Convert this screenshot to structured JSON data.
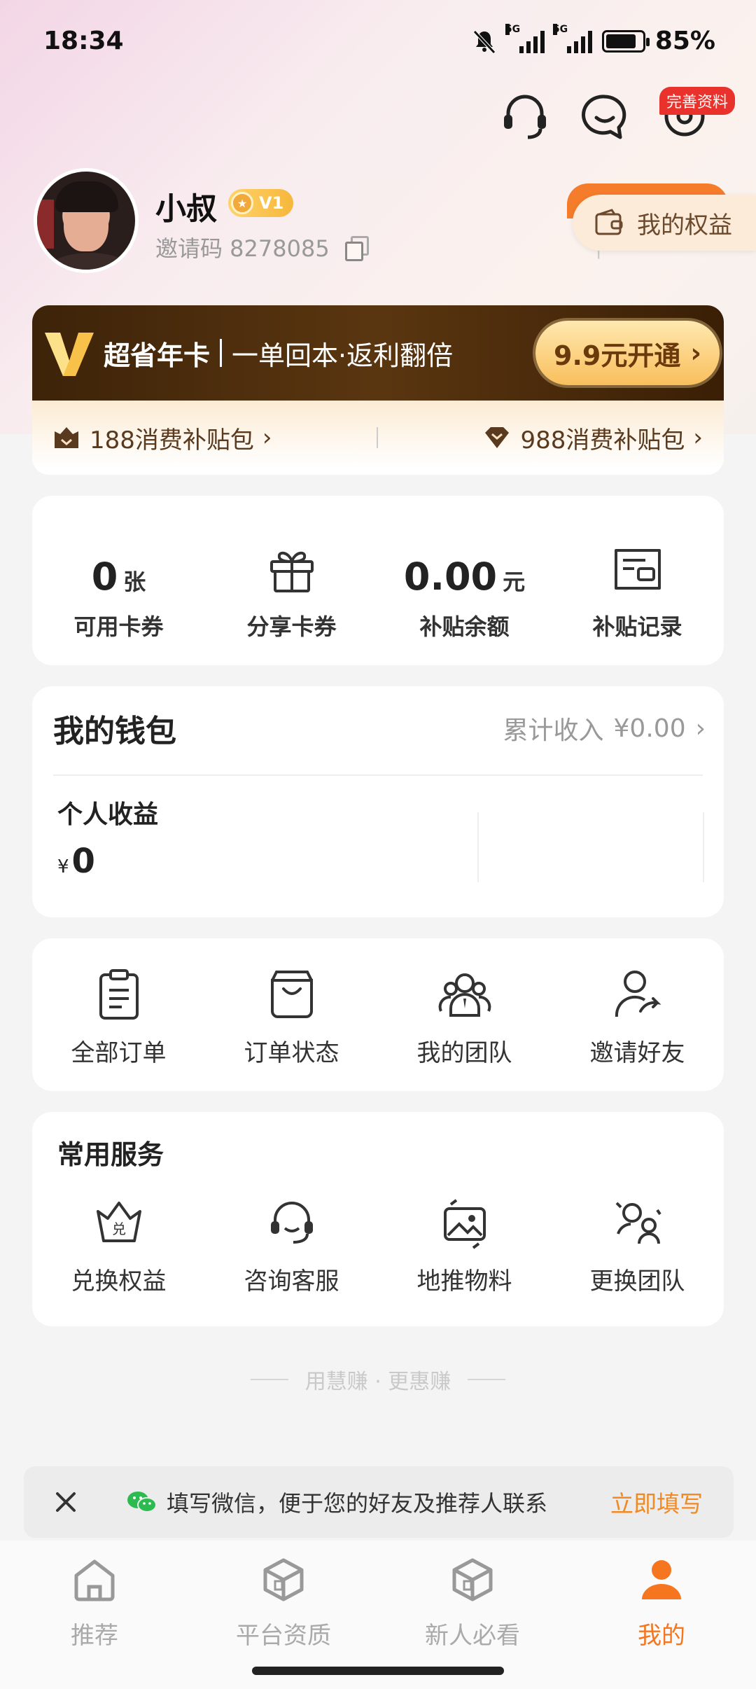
{
  "status_bar": {
    "time": "18:34",
    "battery": "85%",
    "battery_level": 0.85,
    "network": "5G"
  },
  "header": {
    "profile_badge": "完善资料"
  },
  "profile": {
    "name": "小叔",
    "level": "V1",
    "invite_code": "邀请码 8278085",
    "rights_button": "我的权益"
  },
  "vip": {
    "title": "超省年卡",
    "subtitle": "一单回本·返利翻倍",
    "cta": "9.9元开通",
    "packages": [
      "188消费补贴包",
      "988消费补贴包"
    ]
  },
  "stats": [
    {
      "value": "0",
      "unit": "张",
      "label": "可用卡券"
    },
    {
      "icon": "gift-icon",
      "label": "分享卡券"
    },
    {
      "value": "0.00",
      "unit": "元",
      "label": "补贴余额"
    },
    {
      "icon": "receipt-icon",
      "label": "补贴记录"
    }
  ],
  "wallet": {
    "title": "我的钱包",
    "total_label": "累计收入",
    "total_value": "¥0.00",
    "income_label": "个人收益",
    "currency": "¥",
    "income_value": "0"
  },
  "orders": [
    {
      "icon": "clipboard-icon",
      "label": "全部订单"
    },
    {
      "icon": "bag-icon",
      "label": "订单状态"
    },
    {
      "icon": "team-icon",
      "label": "我的团队"
    },
    {
      "icon": "invite-user-icon",
      "label": "邀请好友"
    }
  ],
  "services": {
    "title": "常用服务",
    "items": [
      {
        "icon": "redeem-crown-icon",
        "label": "兑换权益"
      },
      {
        "icon": "headset-icon",
        "label": "咨询客服"
      },
      {
        "icon": "image-refresh-icon",
        "label": "地推物料"
      },
      {
        "icon": "switch-team-icon",
        "label": "更换团队"
      }
    ]
  },
  "slogan": "用慧赚 · 更惠赚",
  "wechat_prompt": {
    "text": "填写微信，便于您的好友及推荐人联系",
    "cta": "立即填写"
  },
  "tabs": [
    {
      "icon": "home-icon",
      "label": "推荐",
      "active": false
    },
    {
      "icon": "cube-icon",
      "label": "平台资质",
      "active": false
    },
    {
      "icon": "cube-icon",
      "label": "新人必看",
      "active": false
    },
    {
      "icon": "person-icon",
      "label": "我的",
      "active": true
    }
  ],
  "colors": {
    "accent": "#f5761f",
    "vip_dark": "#3d2309",
    "vip_gold": "#f9bf5c",
    "badge_red": "#e8322b"
  }
}
